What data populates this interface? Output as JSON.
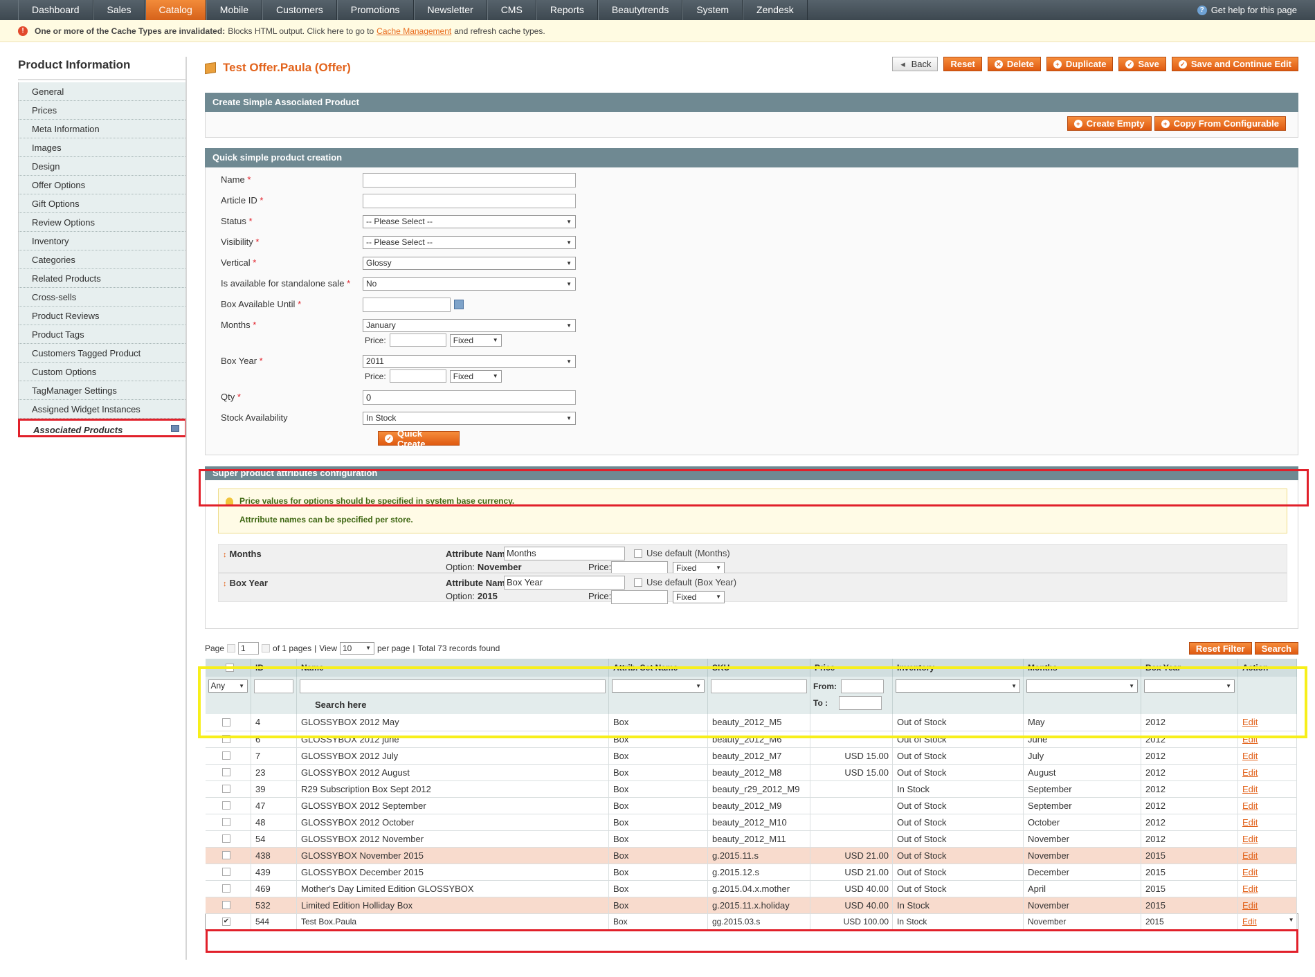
{
  "nav": {
    "items": [
      "Dashboard",
      "Sales",
      "Catalog",
      "Mobile",
      "Customers",
      "Promotions",
      "Newsletter",
      "CMS",
      "Reports",
      "Beautytrends",
      "System",
      "Zendesk"
    ],
    "active": "Catalog",
    "help": "Get help for this page"
  },
  "notice": {
    "bold": "One or more of the Cache Types are invalidated:",
    "text": "Blocks HTML output. Click here to go to",
    "link": "Cache Management",
    "tail": "and refresh cache types."
  },
  "sidebar": {
    "title": "Product Information",
    "tabs": [
      "General",
      "Prices",
      "Meta Information",
      "Images",
      "Design",
      "Offer Options",
      "Gift Options",
      "Review Options",
      "Inventory",
      "Categories",
      "Related Products",
      "Cross-sells",
      "Product Reviews",
      "Product Tags",
      "Customers Tagged Product",
      "Custom Options",
      "TagManager Settings",
      "Assigned Widget Instances",
      "Associated Products"
    ]
  },
  "header": {
    "title": "Test Offer.Paula (Offer)",
    "buttons": {
      "back": "Back",
      "reset": "Reset",
      "delete": "Delete",
      "duplicate": "Duplicate",
      "save": "Save",
      "save_continue": "Save and Continue Edit"
    }
  },
  "create_simple": {
    "title": "Create Simple Associated Product",
    "create_empty": "Create Empty",
    "copy_from": "Copy From Configurable"
  },
  "quick": {
    "title": "Quick simple product creation",
    "name": "Name",
    "article": "Article ID",
    "status": "Status",
    "status_val": "-- Please Select --",
    "visibility": "Visibility",
    "visibility_val": "-- Please Select --",
    "vertical": "Vertical",
    "vertical_val": "Glossy",
    "standalone": "Is available for standalone sale",
    "standalone_val": "No",
    "box_until": "Box Available Until",
    "months": "Months",
    "months_val": "January",
    "price": "Price:",
    "fixed": "Fixed",
    "box_year": "Box Year",
    "box_year_val": "2011",
    "qty": "Qty",
    "qty_val": "0",
    "stock": "Stock Availability",
    "stock_val": "In Stock",
    "quick_create": "Quick Create"
  },
  "super": {
    "title": "Super product attributes configuration",
    "tip1": "Price values for options should be specified in system base currency.",
    "tip2": "Attrribute names can be specified per store.",
    "attr_label": "Attribute Name:",
    "option": "Option:",
    "price": "Price:",
    "fixed": "Fixed",
    "a1": {
      "name": "Months",
      "value": "Months",
      "use_default": "Use default (Months)",
      "option": "November"
    },
    "a2": {
      "name": "Box Year",
      "value": "Box Year",
      "use_default": "Use default (Box Year)",
      "option": "2015"
    }
  },
  "pager": {
    "page": "Page",
    "page_val": "1",
    "of": "of 1 pages",
    "view": "View",
    "view_val": "10",
    "per_page": "per page",
    "total": "Total 73 records found",
    "reset_filter": "Reset Filter",
    "search": "Search"
  },
  "grid": {
    "headers": [
      "ID",
      "Name",
      "Attrib. Set Name",
      "SKU",
      "Price",
      "Inventory",
      "Months",
      "Box Year",
      "Action"
    ],
    "any": "Any",
    "search_here": "Search here",
    "from": "From:",
    "to": "To :",
    "rows": [
      {
        "id": "4",
        "name": "GLOSSYBOX 2012 May",
        "set": "Box",
        "sku": "beauty_2012_M5",
        "price": "",
        "inv": "Out of Stock",
        "month": "May",
        "year": "2012",
        "action": "Edit"
      },
      {
        "id": "6",
        "name": "GLOSSYBOX 2012 june",
        "set": "Box",
        "sku": "beauty_2012_M6",
        "price": "",
        "inv": "Out of Stock",
        "month": "June",
        "year": "2012",
        "action": "Edit"
      },
      {
        "id": "7",
        "name": "GLOSSYBOX 2012 July",
        "set": "Box",
        "sku": "beauty_2012_M7",
        "price": "USD 15.00",
        "inv": "Out of Stock",
        "month": "July",
        "year": "2012",
        "action": "Edit"
      },
      {
        "id": "23",
        "name": "GLOSSYBOX 2012 August",
        "set": "Box",
        "sku": "beauty_2012_M8",
        "price": "USD 15.00",
        "inv": "Out of Stock",
        "month": "August",
        "year": "2012",
        "action": "Edit"
      },
      {
        "id": "39",
        "name": "R29 Subscription Box Sept 2012",
        "set": "Box",
        "sku": "beauty_r29_2012_M9",
        "price": "",
        "inv": "In Stock",
        "month": "September",
        "year": "2012",
        "action": "Edit"
      },
      {
        "id": "47",
        "name": "GLOSSYBOX 2012 September",
        "set": "Box",
        "sku": "beauty_2012_M9",
        "price": "",
        "inv": "Out of Stock",
        "month": "September",
        "year": "2012",
        "action": "Edit"
      },
      {
        "id": "48",
        "name": "GLOSSYBOX 2012 October",
        "set": "Box",
        "sku": "beauty_2012_M10",
        "price": "",
        "inv": "Out of Stock",
        "month": "October",
        "year": "2012",
        "action": "Edit"
      },
      {
        "id": "54",
        "name": "GLOSSYBOX 2012 November",
        "set": "Box",
        "sku": "beauty_2012_M11",
        "price": "",
        "inv": "Out of Stock",
        "month": "November",
        "year": "2012",
        "action": "Edit"
      },
      {
        "id": "438",
        "name": "GLOSSYBOX November 2015",
        "set": "Box",
        "sku": "g.2015.11.s",
        "price": "USD 21.00",
        "inv": "Out of Stock",
        "month": "November",
        "year": "2015",
        "action": "Edit",
        "pink": true
      },
      {
        "id": "439",
        "name": "GLOSSYBOX December 2015",
        "set": "Box",
        "sku": "g.2015.12.s",
        "price": "USD 21.00",
        "inv": "Out of Stock",
        "month": "December",
        "year": "2015",
        "action": "Edit"
      },
      {
        "id": "469",
        "name": "Mother's Day Limited Edition GLOSSYBOX",
        "set": "Box",
        "sku": "g.2015.04.x.mother",
        "price": "USD 40.00",
        "inv": "Out of Stock",
        "month": "April",
        "year": "2015",
        "action": "Edit"
      },
      {
        "id": "532",
        "name": "Limited Edition Holliday Box",
        "set": "Box",
        "sku": "g.2015.11.x.holiday",
        "price": "USD 40.00",
        "inv": "In Stock",
        "month": "November",
        "year": "2015",
        "action": "Edit",
        "pink": true
      },
      {
        "id": "544",
        "name": "Test Box.Paula",
        "set": "Box",
        "sku": "gg.2015.03.s",
        "price": "USD 100.00",
        "inv": "In Stock",
        "month": "November",
        "year": "2015",
        "action": "Edit",
        "checked": true
      }
    ]
  }
}
